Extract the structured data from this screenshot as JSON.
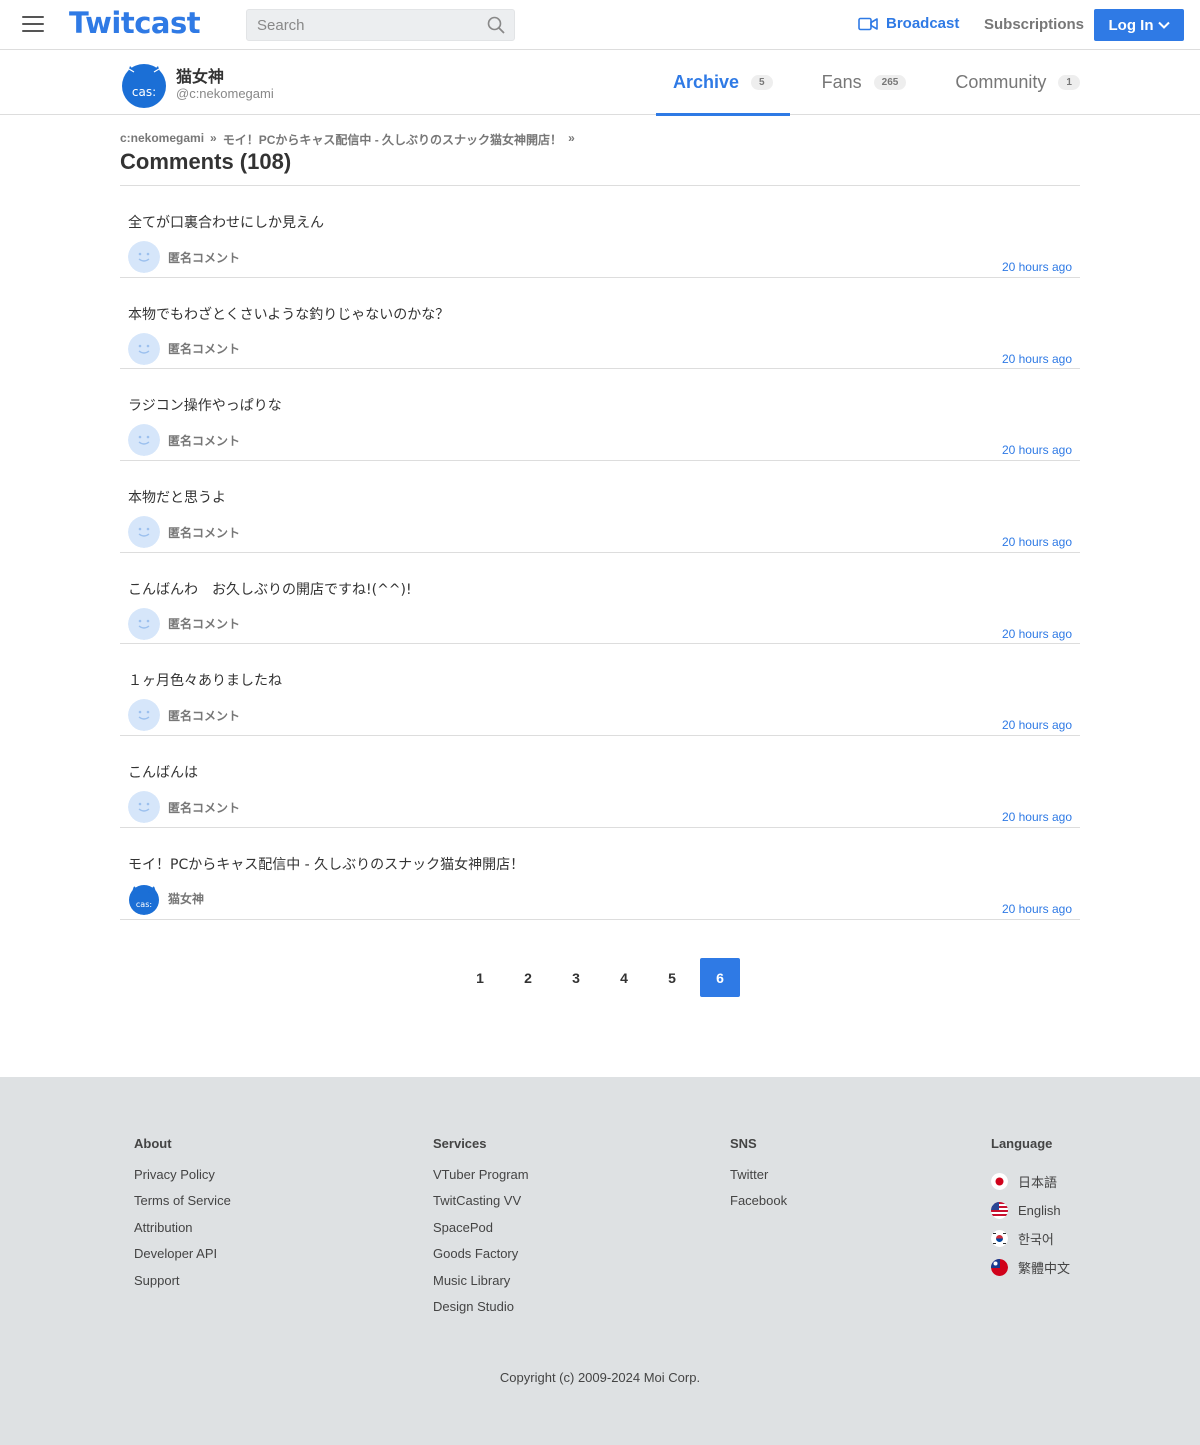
{
  "header": {
    "logo": "Twitcast",
    "search_placeholder": "Search",
    "broadcast": "Broadcast",
    "subscriptions": "Subscriptions",
    "login": "Log In"
  },
  "profile": {
    "name": "猫女神",
    "handle": "@c:nekomegami",
    "avatar_text": "cas:",
    "tabs": [
      {
        "label": "Archive",
        "count": "5"
      },
      {
        "label": "Fans",
        "count": "265"
      },
      {
        "label": "Community",
        "count": "1"
      }
    ]
  },
  "breadcrumb": [
    "c:nekomegami",
    "»",
    "モイ！PCからキャス配信中 - 久しぶりのスナック猫女神開店！",
    "»"
  ],
  "page_title": "Comments (108)",
  "comments": [
    {
      "text": "全てが口裏合わせにしか見えん",
      "user": "匿名コメント",
      "time": "20 hours ago"
    },
    {
      "text": "本物でもわざとくさいような釣りじゃないのかな？",
      "user": "匿名コメント",
      "time": "20 hours ago"
    },
    {
      "text": "ラジコン操作やっぱりな",
      "user": "匿名コメント",
      "time": "20 hours ago"
    },
    {
      "text": "本物だと思うよ",
      "user": "匿名コメント",
      "time": "20 hours ago"
    },
    {
      "text": "こんばんわ　お久しぶりの開店ですね!(^^)!",
      "user": "匿名コメント",
      "time": "20 hours ago"
    },
    {
      "text": "１ヶ月色々ありましたね",
      "user": "匿名コメント",
      "time": "20 hours ago"
    },
    {
      "text": "こんばんは",
      "user": "匿名コメント",
      "time": "20 hours ago"
    },
    {
      "text": "モイ！PCからキャス配信中 - 久しぶりのスナック猫女神開店！",
      "user": "猫女神",
      "time": "20 hours ago"
    }
  ],
  "pagination": {
    "pages": [
      "1",
      "2",
      "3",
      "4",
      "5",
      "6"
    ],
    "current": "6"
  },
  "footer": {
    "about": {
      "title": "About",
      "links": [
        "Privacy Policy",
        "Terms of Service",
        "Attribution",
        "Developer API",
        "Support"
      ]
    },
    "services": {
      "title": "Services",
      "links": [
        "VTuber Program",
        "TwitCasting VV",
        "SpacePod",
        "Goods Factory",
        "Music Library",
        "Design Studio"
      ]
    },
    "sns": {
      "title": "SNS",
      "links": [
        "Twitter",
        "Facebook"
      ]
    },
    "language": {
      "title": "Language",
      "options": [
        "日本語",
        "English",
        "한국어",
        "繁體中文"
      ]
    },
    "copyright": "Copyright (c) 2009-2024 Moi Corp."
  },
  "colors": {
    "accent": "#2f7ae5",
    "footer_bg": "#dee1e3"
  }
}
